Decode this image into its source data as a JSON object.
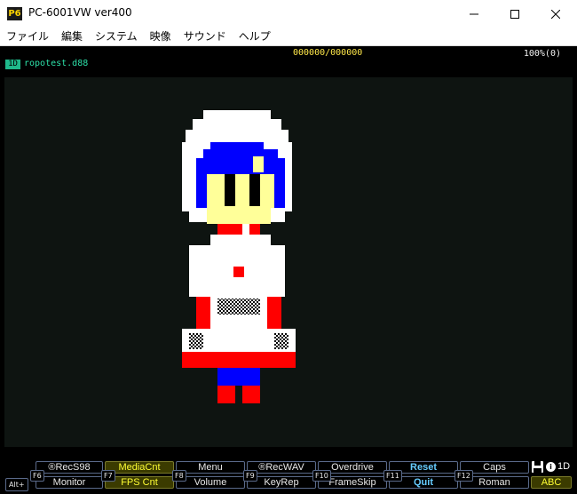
{
  "window": {
    "title": "PC-6001VW ver400",
    "logo": "P6",
    "minimize_icon": "minimize-icon",
    "maximize_icon": "maximize-icon",
    "close_icon": "close-icon"
  },
  "menu": [
    "ファイル",
    "編集",
    "システム",
    "映像",
    "サウンド",
    "ヘルプ"
  ],
  "status": {
    "drive_badge": "1D",
    "disk_name": "ropotest.d88",
    "counter": "000000/000000",
    "zoom": "100%(0)"
  },
  "fkeys": {
    "tags": [
      "F6",
      "F7",
      "F8",
      "F9",
      "F10",
      "F11",
      "F12"
    ],
    "alt_tag": "Alt+",
    "top_row": [
      "®RecS98",
      "MediaCnt",
      "Menu",
      "®RecWAV",
      "Overdrive",
      "Reset",
      "Caps"
    ],
    "bottom_row": [
      "Monitor",
      "FPS Cnt",
      "Volume",
      "KeyRep",
      "FrameSkip",
      "Quit",
      "Roman"
    ],
    "extra": "ABC",
    "drive_status": "1D"
  },
  "colors": {
    "screen_bg": "#0e1411",
    "sprite_white": "#ffffff",
    "sprite_blue": "#0000ff",
    "sprite_yellow": "#ffff99",
    "sprite_black": "#000000",
    "sprite_red": "#ff0000",
    "highlight": "#ffff33"
  }
}
